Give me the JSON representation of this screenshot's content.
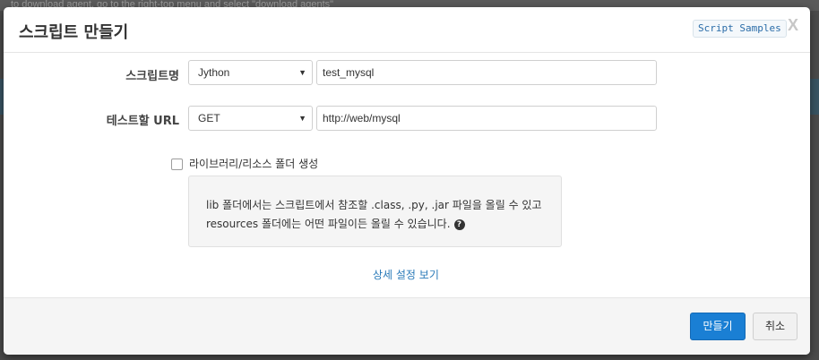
{
  "background": {
    "ghost_text": "to download agent, go to the right-top menu and select \"download agents\""
  },
  "dialog": {
    "title": "스크립트 만들기",
    "samples_label": "Script Samples",
    "close_label": "X"
  },
  "form": {
    "script_name_label": "스크립트명",
    "language": {
      "selected": "Jython"
    },
    "script_name_value": "test_mysql",
    "test_url_label": "테스트할 URL",
    "method": {
      "selected": "GET"
    },
    "url_value": "http://web/mysql",
    "create_folder_label": "라이브러리/리소스 폴더 생성",
    "create_folder_checked": false,
    "info_line1": "lib 폴더에서는 스크립트에서 참조할 .class, .py, .jar 파일을 올릴 수 있고",
    "info_line2": "resources 폴더에는 어떤 파일이든 올릴 수 있습니다.",
    "help_glyph": "?",
    "advanced_link": "상세 설정 보기"
  },
  "footer": {
    "create_label": "만들기",
    "cancel_label": "취소"
  },
  "colors": {
    "primary": "#1a7fd4",
    "link": "#2a7ab8"
  }
}
